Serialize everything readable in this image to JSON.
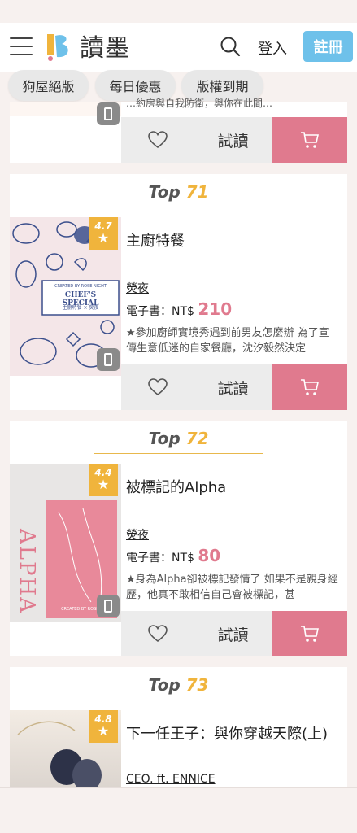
{
  "header": {
    "logo_text": "讀墨",
    "login_label": "登入",
    "register_label": "註冊",
    "brand_color": "#6ec1ea"
  },
  "categories": [
    "狗屋絕版",
    "每日優惠",
    "版權到期"
  ],
  "actions": {
    "trial_label": "試讀"
  },
  "colors": {
    "accent_gold": "#f0b43c",
    "price_pink": "#e07a8e"
  },
  "partial_prev_card": {
    "desc_fragment": "…約房與自我防衛，與你在此間…"
  },
  "books": [
    {
      "rank_prefix": "Top",
      "rank": "71",
      "rating": "4.7",
      "title": "主廚特餐",
      "author": "熒夜",
      "price_label": "電子書：",
      "currency": "NT$",
      "price": "210",
      "description": "★參加廚師實境秀遇到前男友怎麼辦 為了宣傳生意低迷的自家餐廳，沈汐毅然決定",
      "cover_title": "CHEF'S SPECIAL",
      "cover_subtitle": "主廚特餐 × 熒夜",
      "cover_credit": "CREATED BY ROSE NIGHT"
    },
    {
      "rank_prefix": "Top",
      "rank": "72",
      "rating": "4.4",
      "title": "被標記的Alpha",
      "author": "熒夜",
      "price_label": "電子書：",
      "currency": "NT$",
      "price": "80",
      "description": "★身為Alpha卻被標記發情了 如果不是親身經歷，他真不敢相信自己會被標記，甚",
      "cover_title": "ALPHA",
      "cover_credit": "CREATED BY ROSE NIGHT"
    },
    {
      "rank_prefix": "Top",
      "rank": "73",
      "rating": "4.8",
      "title": "下一任王子：與你穿越天際(上)",
      "author": "CEO. ft. ENNICE"
    }
  ]
}
